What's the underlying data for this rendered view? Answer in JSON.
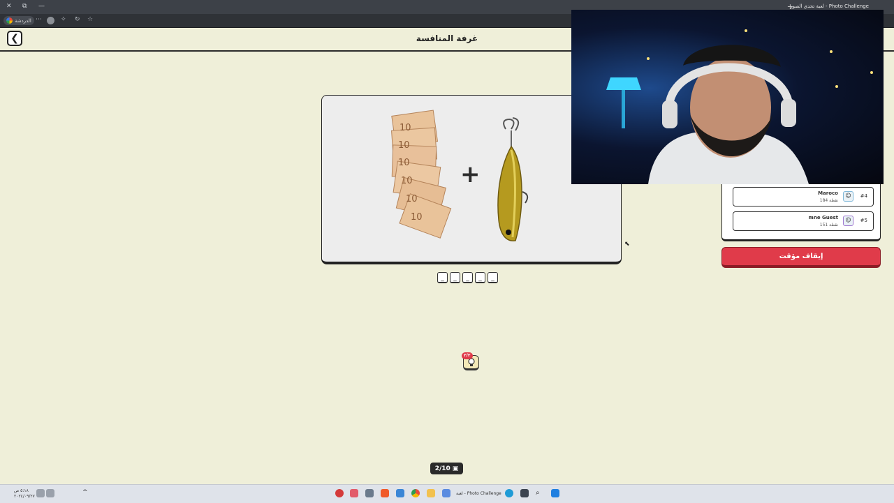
{
  "browser": {
    "tab_title": "لعبة تحدي الصور - Photo Challenge",
    "profile_label": "الدردشة"
  },
  "header": {
    "title": "غرفة المنافسة",
    "back_icon": "chevron-left-icon"
  },
  "puzzle": {
    "operator": "+",
    "left_image": "banknotes-fan",
    "right_image": "fishing-lure",
    "answer_slots": [
      "_",
      "_",
      "_",
      "_",
      "_"
    ]
  },
  "hint": {
    "badge": "٢/٢",
    "icon": "lightbulb-icon"
  },
  "progress": {
    "label": "2/10",
    "icon": "image-icon"
  },
  "leaderboard": {
    "rows": [
      {
        "rank": "#4",
        "name": "Maroco",
        "points": "184 نقطة"
      },
      {
        "rank": "#5",
        "name": "mne Guest",
        "points": "151 نقطة"
      }
    ]
  },
  "controls": {
    "pause_label": "إيقاف مؤقت"
  },
  "taskbar": {
    "app_label": "لعبة - Photo Challenge",
    "time": "٥:١٨ ص",
    "date": "٢٠٢٤/٠٩/٢٧"
  },
  "colors": {
    "background": "#efefd9",
    "danger": "#e03b4a",
    "ink": "#222222"
  }
}
